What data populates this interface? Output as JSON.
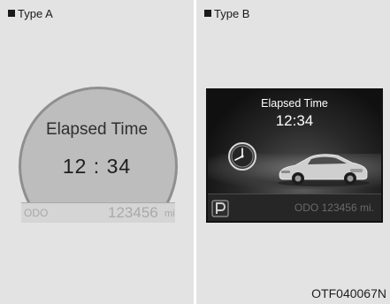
{
  "type_a": {
    "label": "Type A",
    "title": "Elapsed Time",
    "time": "12 : 34",
    "odo_label": "ODO",
    "odo_value": "123456",
    "odo_unit": "mi"
  },
  "type_b": {
    "label": "Type B",
    "title": "Elapsed Time",
    "time": "12:34",
    "odo_label": "ODO",
    "odo_value": "123456",
    "odo_unit": "mi.",
    "icons": [
      "clock-icon",
      "car-icon",
      "parking-icon"
    ]
  },
  "figure_code": "OTF040067N"
}
